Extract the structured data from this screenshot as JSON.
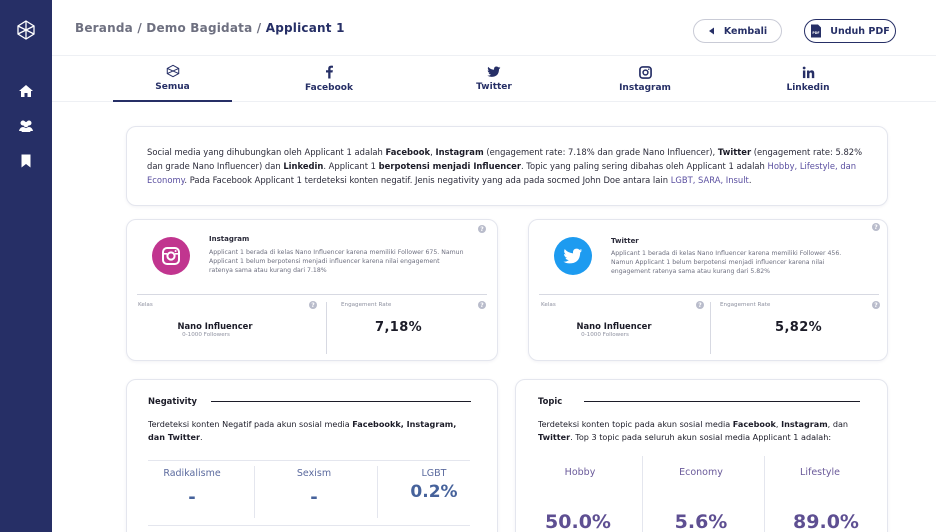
{
  "breadcrumb": {
    "home": "Beranda",
    "sep": " / ",
    "demo": "Demo Bagidata",
    "current": "Applicant 1"
  },
  "header": {
    "back_label": "Kembali",
    "pdf_label": "Unduh PDF",
    "pdf_badge": "PDF"
  },
  "tabs": [
    {
      "label": "Semua",
      "icon": "network-icon",
      "active": true
    },
    {
      "label": "Facebook",
      "icon": "facebook-icon"
    },
    {
      "label": "Twitter",
      "icon": "twitter-icon"
    },
    {
      "label": "Instagram",
      "icon": "instagram-icon"
    },
    {
      "label": "Linkedin",
      "icon": "linkedin-icon"
    }
  ],
  "summary": {
    "t1": "Social media yang dihubungkan oleh Applicant 1 adalah ",
    "facebook": "Facebook",
    "comma": ", ",
    "instagram": "Instagram",
    "t2": " (engagement rate: 7.18% dan grade Nano Influencer), ",
    "twitter": "Twitter",
    "t3": " (engagement rate: 5.82% dan grade Nano Influencer) dan ",
    "linkedin": "Linkedin",
    "t4": ".  Applicant 1 ",
    "potential": "berpotensi menjadi Influencer",
    "t5": ". Topic yang paling sering dibahas oleh  Applicant 1 adalah ",
    "topics": "Hobby, Lifestyle, dan Economy",
    "t6": ". Pada Facebook  Applicant 1 terdeteksi konten negatif. Jenis negativity yang ada pada socmed John Doe antara lain ",
    "negativity": "LGBT, SARA, Insult",
    "t7": "."
  },
  "instagram_card": {
    "name": "Instagram",
    "desc": "Applicant 1 berada di kelas Nano Influencer karena memiliki Follower 675. Namun Applicant 1 belum berpotensi menjadi influencer karena nilai engagement ratenya sama atau kurang dari 7.18%",
    "kelas_label": "Kelas",
    "kelas_value": "Nano Influencer",
    "followers_range": "0-1000 Followers",
    "rate_label": "Engagement Rate",
    "rate_value": "7,18%",
    "help": "?"
  },
  "twitter_card": {
    "name": "Twitter",
    "desc": "Applicant 1 berada di kelas Nano Influencer karena memiliki Follower 456. Namun  Applicant 1 belum berpotensi menjadi influencer karena nilai engagement ratenya sama atau kurang dari 5.82%",
    "kelas_label": "Kelas",
    "kelas_value": "Nano Influencer",
    "followers_range": "0-1000 Followers",
    "rate_label": "Engagement Rate",
    "rate_value": "5,82%",
    "help": "?"
  },
  "negativity": {
    "title": "Negativity",
    "t1": "Terdeteksi konten Negatif pada akun sosial media ",
    "accounts": "Facebookk, Instagram, dan Twitter",
    "t2": ".",
    "stats": [
      {
        "label": "Radikalisme",
        "value": "-"
      },
      {
        "label": "Sexism",
        "value": "-"
      },
      {
        "label": "LGBT",
        "value": "0.2%"
      }
    ]
  },
  "topic": {
    "title": "Topic",
    "t1": "Terdeteksi konten topic pada akun sosial media ",
    "fb": "Facebook",
    "comma": ", ",
    "ig": "Instagram",
    "t2": ",  dan ",
    "tw": "Twitter",
    "t3": ". Top 3 topic pada seluruh akun sosial media Applicant 1 adalah:",
    "stats": [
      {
        "label": "Hobby",
        "value": "50.0%"
      },
      {
        "label": "Economy",
        "value": "5.6%"
      },
      {
        "label": "Lifestyle",
        "value": "89.0%"
      }
    ]
  },
  "colors": {
    "sidebar": "#262f66",
    "instagram": "#c1358f",
    "twitter": "#1d9bf0",
    "accent": "#262f66"
  }
}
